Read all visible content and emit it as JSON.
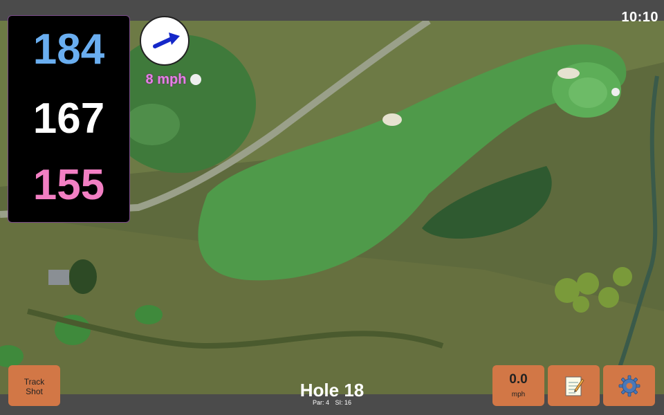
{
  "status_bar": {
    "time": "10:10"
  },
  "distances": {
    "back": "184",
    "middle": "167",
    "front": "155",
    "colors": {
      "back": "#6aaef0",
      "middle": "#ffffff",
      "front": "#f27fc3"
    }
  },
  "wind": {
    "speed_label": "8 mph",
    "icon": "wind-direction-arrow",
    "direction": "east-northeast"
  },
  "hole": {
    "title": "Hole 18",
    "par": "Par: 4",
    "si": "SI: 16"
  },
  "buttons": {
    "track_shot": {
      "line1": "Track",
      "line2": "Shot"
    },
    "speed": {
      "value": "0.0",
      "unit": "mph"
    },
    "notes": {
      "icon": "notepad-icon"
    },
    "settings": {
      "icon": "gear-icon"
    }
  },
  "theme": {
    "accent": "#d27746",
    "panel_bg": "#000000",
    "bar_bg": "#4b4b4b"
  }
}
